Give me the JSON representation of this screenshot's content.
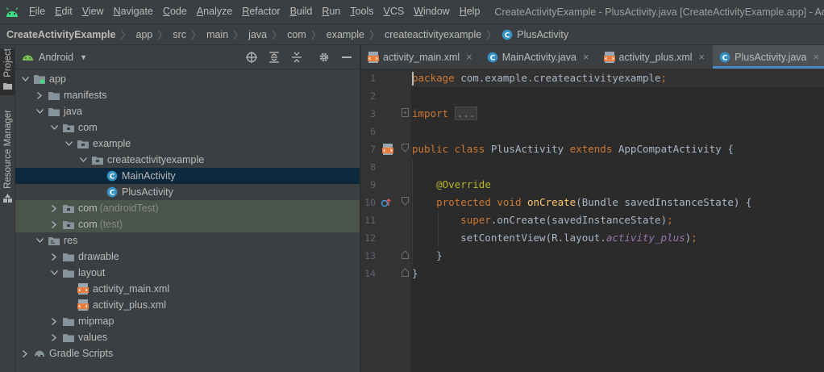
{
  "menubar": {
    "items": [
      "File",
      "Edit",
      "View",
      "Navigate",
      "Code",
      "Analyze",
      "Refactor",
      "Build",
      "Run",
      "Tools",
      "VCS",
      "Window",
      "Help"
    ],
    "window_title": "CreateActivityExample - PlusActivity.java [CreateActivityExample.app] - Admin"
  },
  "breadcrumb": [
    "CreateActivityExample",
    "app",
    "src",
    "main",
    "java",
    "com",
    "example",
    "createactivityexample",
    "PlusActivity"
  ],
  "toolstrip": {
    "project_label": "Project",
    "resource_label": "Resource Manager"
  },
  "project": {
    "view_label": "Android",
    "tree": [
      {
        "label": "app",
        "suffix": "",
        "depth": 0,
        "chevron": "open",
        "icon": "module-icon"
      },
      {
        "label": "manifests",
        "suffix": "",
        "depth": 1,
        "chevron": "closed",
        "icon": "folder-icon"
      },
      {
        "label": "java",
        "suffix": "",
        "depth": 1,
        "chevron": "open",
        "icon": "folder-icon"
      },
      {
        "label": "com",
        "suffix": "",
        "depth": 2,
        "chevron": "open",
        "icon": "package-icon"
      },
      {
        "label": "example",
        "suffix": "",
        "depth": 3,
        "chevron": "open",
        "icon": "package-icon"
      },
      {
        "label": "createactivityexample",
        "suffix": "",
        "depth": 4,
        "chevron": "open",
        "icon": "package-icon"
      },
      {
        "label": "MainActivity",
        "suffix": "",
        "depth": 5,
        "chevron": "none",
        "icon": "class-icon",
        "selected": true
      },
      {
        "label": "PlusActivity",
        "suffix": "",
        "depth": 5,
        "chevron": "none",
        "icon": "class-icon"
      },
      {
        "label": "com",
        "suffix": "(androidTest)",
        "depth": 2,
        "chevron": "closed",
        "icon": "package-icon",
        "test": true
      },
      {
        "label": "com",
        "suffix": "(test)",
        "depth": 2,
        "chevron": "closed",
        "icon": "package-icon",
        "test": true
      },
      {
        "label": "res",
        "suffix": "",
        "depth": 1,
        "chevron": "open",
        "icon": "res-folder-icon"
      },
      {
        "label": "drawable",
        "suffix": "",
        "depth": 2,
        "chevron": "closed",
        "icon": "folder-icon"
      },
      {
        "label": "layout",
        "suffix": "",
        "depth": 2,
        "chevron": "open",
        "icon": "folder-icon"
      },
      {
        "label": "activity_main.xml",
        "suffix": "",
        "depth": 3,
        "chevron": "none",
        "icon": "xml-file-icon"
      },
      {
        "label": "activity_plus.xml",
        "suffix": "",
        "depth": 3,
        "chevron": "none",
        "icon": "xml-file-icon"
      },
      {
        "label": "mipmap",
        "suffix": "",
        "depth": 2,
        "chevron": "closed",
        "icon": "folder-icon"
      },
      {
        "label": "values",
        "suffix": "",
        "depth": 2,
        "chevron": "closed",
        "icon": "folder-icon"
      },
      {
        "label": "Gradle Scripts",
        "suffix": "",
        "depth": 0,
        "chevron": "closed",
        "icon": "gradle-icon"
      }
    ]
  },
  "editor": {
    "tabs": [
      {
        "label": "activity_main.xml",
        "icon": "xml-file-icon",
        "active": false
      },
      {
        "label": "MainActivity.java",
        "icon": "class-icon",
        "active": false
      },
      {
        "label": "activity_plus.xml",
        "icon": "xml-file-icon",
        "active": false
      },
      {
        "label": "PlusActivity.java",
        "icon": "class-icon",
        "active": true
      }
    ],
    "line_numbers": [
      "1",
      "2",
      "3",
      "6",
      "7",
      "8",
      "9",
      "10",
      "11",
      "12",
      "13",
      "14"
    ],
    "code": [
      {
        "segments": [
          {
            "t": "package",
            "c": "kw"
          },
          {
            "t": " com.example.createactivityexample",
            "c": ""
          },
          {
            "t": ";",
            "c": "kw"
          }
        ]
      },
      {
        "segments": []
      },
      {
        "segments": [
          {
            "t": "import",
            "c": "kw"
          },
          {
            "t": " ",
            "c": ""
          },
          {
            "t": "...",
            "c": "fold"
          }
        ]
      },
      {
        "segments": []
      },
      {
        "segments": [
          {
            "t": "public class",
            "c": "kw"
          },
          {
            "t": " PlusActivity ",
            "c": ""
          },
          {
            "t": "extends",
            "c": "kw"
          },
          {
            "t": " AppCompatActivity {",
            "c": ""
          }
        ]
      },
      {
        "segments": []
      },
      {
        "segments": [
          {
            "t": "    ",
            "c": ""
          },
          {
            "t": "@Override",
            "c": "ann"
          }
        ]
      },
      {
        "segments": [
          {
            "t": "    ",
            "c": ""
          },
          {
            "t": "protected void",
            "c": "kw"
          },
          {
            "t": " ",
            "c": ""
          },
          {
            "t": "onCreate",
            "c": "fn"
          },
          {
            "t": "(Bundle savedInstanceState) {",
            "c": ""
          }
        ]
      },
      {
        "segments": [
          {
            "t": "        ",
            "c": ""
          },
          {
            "t": "super",
            "c": "kw"
          },
          {
            "t": ".onCreate(savedInstanceState)",
            "c": ""
          },
          {
            "t": ";",
            "c": "kw"
          }
        ]
      },
      {
        "segments": [
          {
            "t": "        setContentView(R.layout.",
            "c": ""
          },
          {
            "t": "activity_plus",
            "c": "fld"
          },
          {
            "t": ")",
            "c": ""
          },
          {
            "t": ";",
            "c": "kw"
          }
        ]
      },
      {
        "segments": [
          {
            "t": "    }",
            "c": ""
          }
        ]
      },
      {
        "segments": [
          {
            "t": "}",
            "c": ""
          }
        ]
      }
    ]
  }
}
